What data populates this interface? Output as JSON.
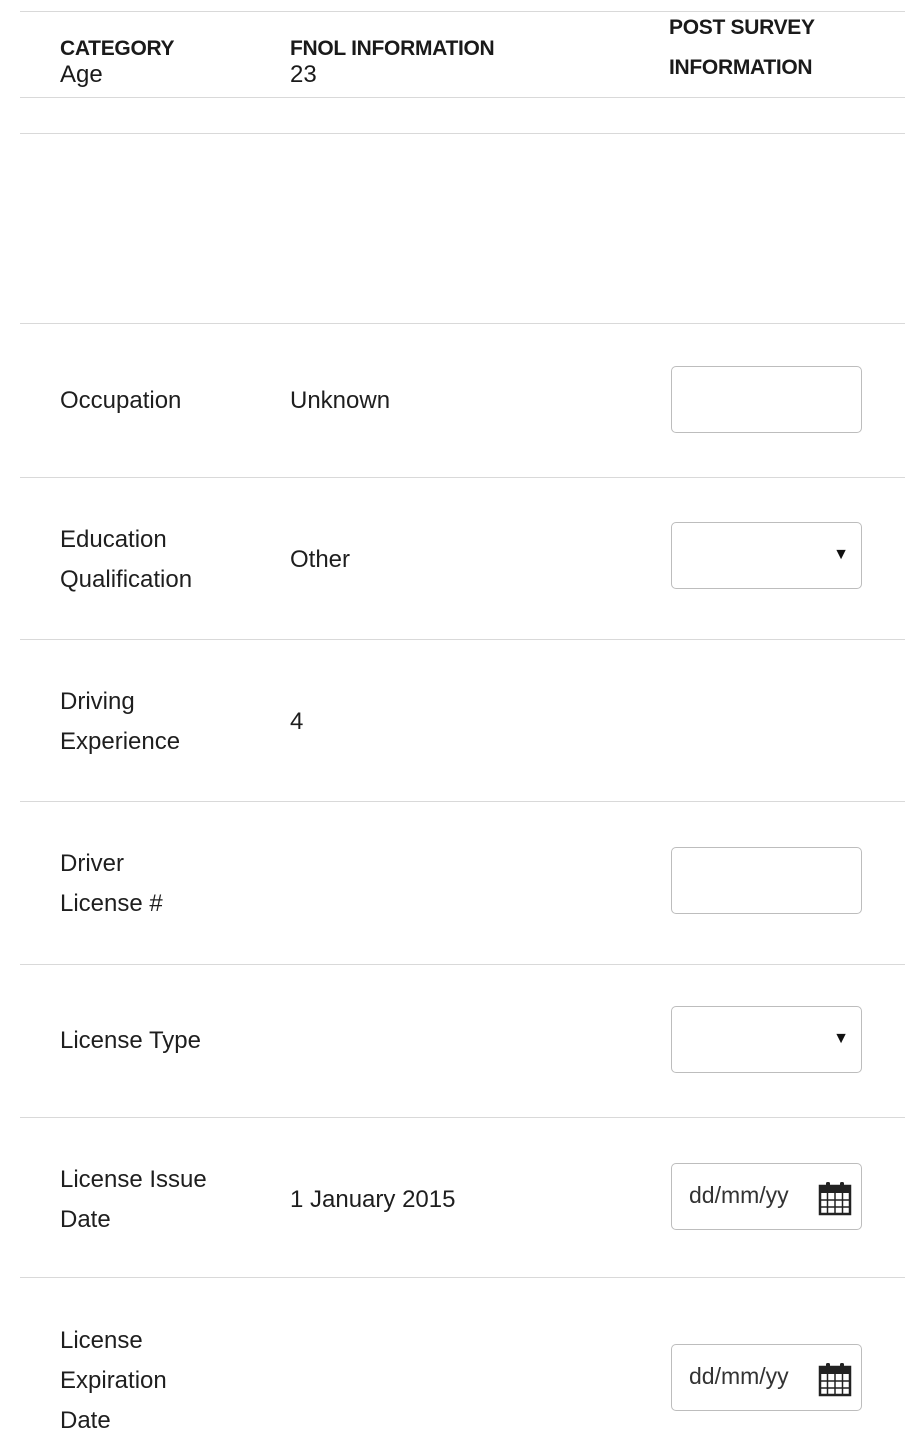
{
  "header": {
    "category_label": "CATEGORY",
    "category_value": "Age",
    "fnol_label": "FNOL INFORMATION",
    "fnol_value": "23",
    "post_survey_line1": "POST SURVEY",
    "post_survey_line2": "INFORMATION"
  },
  "rows": {
    "occupation": {
      "label": "Occupation",
      "fnol": "Unknown"
    },
    "education": {
      "label_line1": "Education",
      "label_line2": "Qualification",
      "fnol": "Other"
    },
    "driving_experience": {
      "label_line1": "Driving",
      "label_line2": "Experience",
      "fnol": "4"
    },
    "driver_license": {
      "label_line1": "Driver",
      "label_line2": "License #"
    },
    "license_type": {
      "label": "License Type"
    },
    "license_issue_date": {
      "label_line1": "License Issue",
      "label_line2": "Date",
      "fnol": "1 January 2015",
      "placeholder": "dd/mm/yy"
    },
    "license_expiration_date": {
      "label_line1": "License",
      "label_line2": "Expiration",
      "label_line3": "Date",
      "placeholder": "dd/mm/yy"
    }
  },
  "icons": {
    "dropdown_caret": "▼",
    "calendar": "calendar-icon"
  }
}
